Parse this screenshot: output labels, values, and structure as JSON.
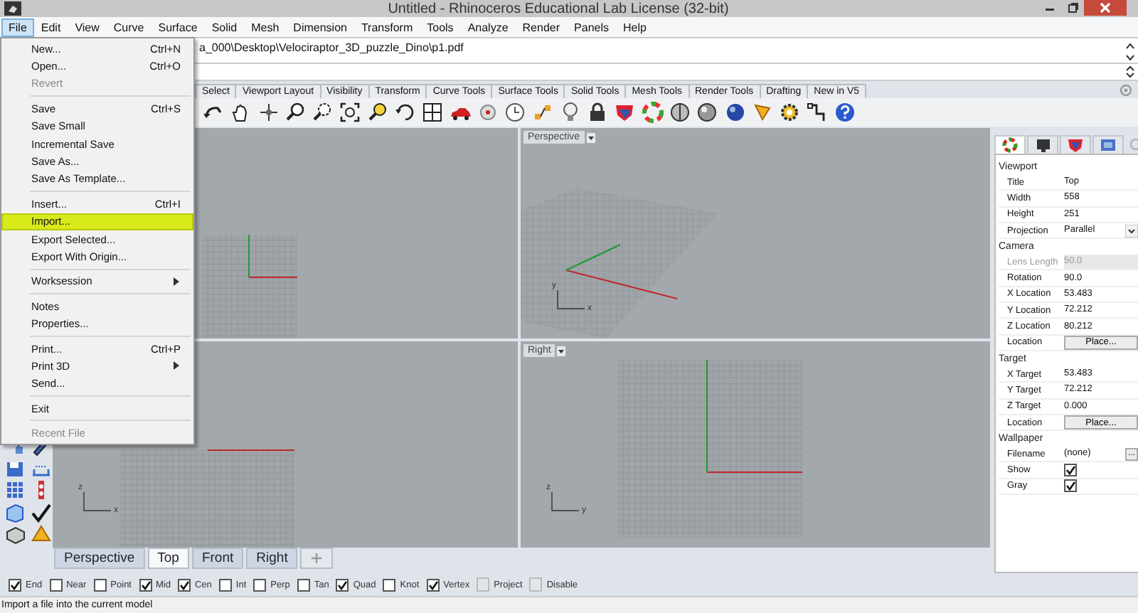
{
  "window": {
    "title": "Untitled - Rhinoceros Educational Lab License (32-bit)"
  },
  "menu_bar": [
    {
      "label": "File",
      "selected": true
    },
    {
      "label": "Edit",
      "selected": false
    },
    {
      "label": "View",
      "selected": false
    },
    {
      "label": "Curve",
      "selected": false
    },
    {
      "label": "Surface",
      "selected": false
    },
    {
      "label": "Solid",
      "selected": false
    },
    {
      "label": "Mesh",
      "selected": false
    },
    {
      "label": "Dimension",
      "selected": false
    },
    {
      "label": "Transform",
      "selected": false
    },
    {
      "label": "Tools",
      "selected": false
    },
    {
      "label": "Analyze",
      "selected": false
    },
    {
      "label": "Render",
      "selected": false
    },
    {
      "label": "Panels",
      "selected": false
    },
    {
      "label": "Help",
      "selected": false
    }
  ],
  "command_history": {
    "text": "a_000\\Desktop\\Velociraptor_3D_puzzle_Dino\\p1.pdf"
  },
  "toolbar_tabs": [
    "Select",
    "Viewport Layout",
    "Visibility",
    "Transform",
    "Curve Tools",
    "Surface Tools",
    "Solid Tools",
    "Mesh Tools",
    "Render Tools",
    "Drafting",
    "New in V5"
  ],
  "viewports": [
    {
      "kind": "top"
    },
    {
      "kind": "perspective",
      "label": "Perspective",
      "axis_labels": [
        "y",
        "x"
      ]
    },
    {
      "kind": "front",
      "axis_labels": [
        "z",
        "x"
      ]
    },
    {
      "kind": "right",
      "label": "Right",
      "axis_labels": [
        "z",
        "y"
      ]
    }
  ],
  "viewport_tabs": [
    {
      "label": "Perspective",
      "selected": false
    },
    {
      "label": "Top",
      "selected": true
    },
    {
      "label": "Front",
      "selected": false
    },
    {
      "label": "Right",
      "selected": false
    }
  ],
  "osnaps": [
    {
      "label": "End",
      "checked": true,
      "kind": "check"
    },
    {
      "label": "Near",
      "checked": false,
      "kind": "check"
    },
    {
      "label": "Point",
      "checked": false,
      "kind": "check"
    },
    {
      "label": "Mid",
      "checked": true,
      "kind": "check"
    },
    {
      "label": "Cen",
      "checked": true,
      "kind": "check"
    },
    {
      "label": "Int",
      "checked": false,
      "kind": "check"
    },
    {
      "label": "Perp",
      "checked": false,
      "kind": "check"
    },
    {
      "label": "Tan",
      "checked": false,
      "kind": "check"
    },
    {
      "label": "Quad",
      "checked": true,
      "kind": "check"
    },
    {
      "label": "Knot",
      "checked": false,
      "kind": "check"
    },
    {
      "label": "Vertex",
      "checked": true,
      "kind": "check"
    },
    {
      "label": "Project",
      "checked": false,
      "kind": "toggle"
    },
    {
      "label": "Disable",
      "checked": false,
      "kind": "toggle"
    }
  ],
  "status_bar": {
    "text": "Import a file into the current model"
  },
  "properties": {
    "sections": [
      {
        "title": "Viewport",
        "rows": [
          {
            "label": "Title",
            "value": "Top",
            "kind": "text",
            "disabled": false
          },
          {
            "label": "Width",
            "value": "558",
            "kind": "text",
            "disabled": false
          },
          {
            "label": "Height",
            "value": "251",
            "kind": "text",
            "disabled": false
          },
          {
            "label": "Projection",
            "value": "Parallel",
            "kind": "dropdown",
            "disabled": false
          }
        ]
      },
      {
        "title": "Camera",
        "rows": [
          {
            "label": "Lens Length",
            "value": "50.0",
            "kind": "text",
            "disabled": true
          },
          {
            "label": "Rotation",
            "value": "90.0",
            "kind": "text",
            "disabled": false
          },
          {
            "label": "X Location",
            "value": "53.483",
            "kind": "text",
            "disabled": false
          },
          {
            "label": "Y Location",
            "value": "72.212",
            "kind": "text",
            "disabled": false
          },
          {
            "label": "Z Location",
            "value": "80.212",
            "kind": "text",
            "disabled": false
          },
          {
            "label": "Location",
            "value": "Place...",
            "kind": "button",
            "disabled": false
          }
        ]
      },
      {
        "title": "Target",
        "rows": [
          {
            "label": "X Target",
            "value": "53.483",
            "kind": "text",
            "disabled": false
          },
          {
            "label": "Y Target",
            "value": "72.212",
            "kind": "text",
            "disabled": false
          },
          {
            "label": "Z Target",
            "value": "0.000",
            "kind": "text",
            "disabled": false
          },
          {
            "label": "Location",
            "value": "Place...",
            "kind": "button",
            "disabled": false
          }
        ]
      },
      {
        "title": "Wallpaper",
        "rows": [
          {
            "label": "Filename",
            "value": "(none)",
            "kind": "browse",
            "browse": "...",
            "disabled": false
          },
          {
            "label": "Show",
            "checked": true,
            "kind": "check",
            "disabled": false
          },
          {
            "label": "Gray",
            "checked": true,
            "kind": "check",
            "disabled": false
          }
        ]
      }
    ]
  },
  "file_menu": {
    "items": [
      {
        "kind": "item",
        "label": "New...",
        "shortcut": "Ctrl+N",
        "disabled": false,
        "selected": false,
        "submenu": false
      },
      {
        "kind": "item",
        "label": "Open...",
        "shortcut": "Ctrl+O",
        "disabled": false,
        "selected": false,
        "submenu": false
      },
      {
        "kind": "item",
        "label": "Revert",
        "disabled": true,
        "selected": false,
        "submenu": false
      },
      {
        "kind": "separator"
      },
      {
        "kind": "item",
        "label": "Save",
        "shortcut": "Ctrl+S",
        "disabled": false,
        "selected": false,
        "submenu": false
      },
      {
        "kind": "item",
        "label": "Save Small",
        "disabled": false,
        "selected": false,
        "submenu": false
      },
      {
        "kind": "item",
        "label": "Incremental Save",
        "disabled": false,
        "selected": false,
        "submenu": false
      },
      {
        "kind": "item",
        "label": "Save As...",
        "disabled": false,
        "selected": false,
        "submenu": false
      },
      {
        "kind": "item",
        "label": "Save As Template...",
        "disabled": false,
        "selected": false,
        "submenu": false
      },
      {
        "kind": "separator"
      },
      {
        "kind": "item",
        "label": "Insert...",
        "shortcut": "Ctrl+I",
        "disabled": false,
        "selected": false,
        "submenu": false
      },
      {
        "kind": "item",
        "label": "Import...",
        "disabled": false,
        "selected": true,
        "submenu": false
      },
      {
        "kind": "item",
        "label": "Export Selected...",
        "disabled": false,
        "selected": false,
        "submenu": false
      },
      {
        "kind": "item",
        "label": "Export With Origin...",
        "disabled": false,
        "selected": false,
        "submenu": false
      },
      {
        "kind": "separator"
      },
      {
        "kind": "item",
        "label": "Worksession",
        "disabled": false,
        "selected": false,
        "submenu": true
      },
      {
        "kind": "separator"
      },
      {
        "kind": "item",
        "label": "Notes",
        "disabled": false,
        "selected": false,
        "submenu": false
      },
      {
        "kind": "item",
        "label": "Properties...",
        "disabled": false,
        "selected": false,
        "submenu": false
      },
      {
        "kind": "separator"
      },
      {
        "kind": "item",
        "label": "Print...",
        "shortcut": "Ctrl+P",
        "disabled": false,
        "selected": false,
        "submenu": false
      },
      {
        "kind": "item",
        "label": "Print 3D",
        "disabled": false,
        "selected": false,
        "submenu": true
      },
      {
        "kind": "item",
        "label": "Send...",
        "disabled": false,
        "selected": false,
        "submenu": false
      },
      {
        "kind": "separator"
      },
      {
        "kind": "item",
        "label": "Exit",
        "disabled": false,
        "selected": false,
        "submenu": false
      },
      {
        "kind": "separator"
      },
      {
        "kind": "item",
        "label": "Recent File",
        "disabled": true,
        "selected": false,
        "submenu": false
      }
    ]
  }
}
